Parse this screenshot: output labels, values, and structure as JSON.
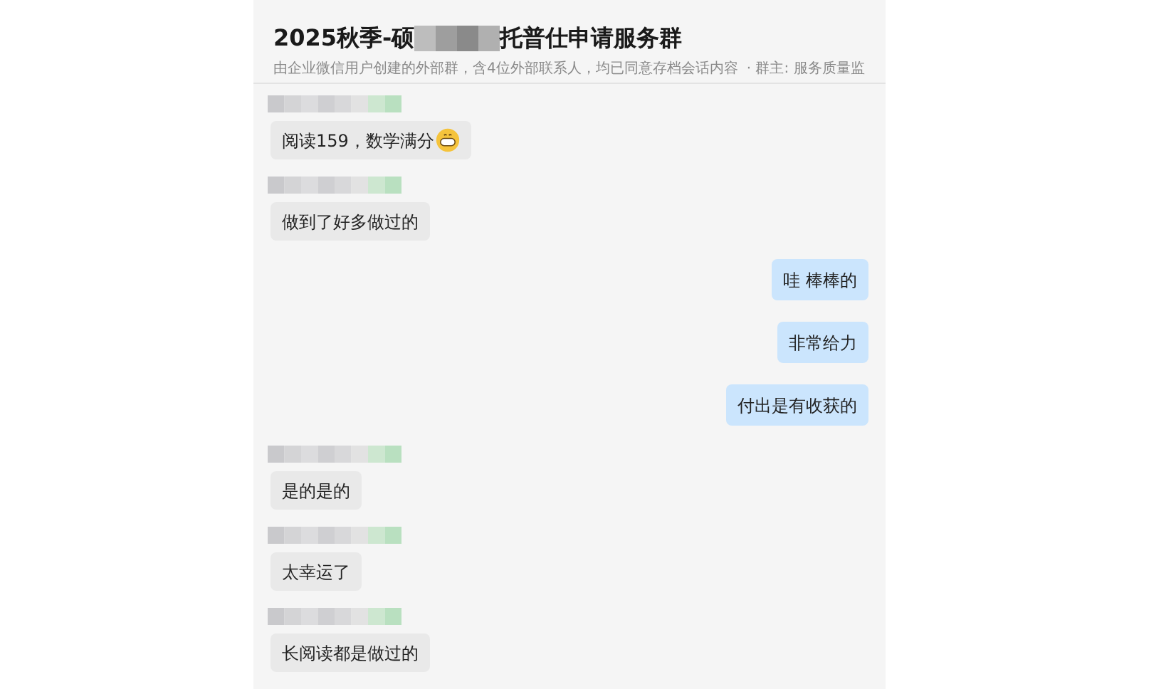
{
  "header": {
    "title_start": "2025秋季-硕",
    "title_end": "托普仕申请服务群",
    "subtitle": "由企业微信用户创建的外部群，含4位外部联系人，均已同意存档会话内容",
    "owner": "· 群主: 服务质量监"
  },
  "messages": [
    {
      "kind": "incoming",
      "text": "阅读159，数学满分",
      "trailing_emoji": true
    },
    {
      "kind": "incoming",
      "text": "做到了好多做过的",
      "trailing_emoji": false
    },
    {
      "kind": "outgoing",
      "text": "哇 棒棒的",
      "trailing_emoji": false
    },
    {
      "kind": "outgoing",
      "text": "非常给力",
      "trailing_emoji": false
    },
    {
      "kind": "outgoing",
      "text": "付出是有收获的",
      "trailing_emoji": false
    },
    {
      "kind": "incoming",
      "text": "是的是的",
      "trailing_emoji": false
    },
    {
      "kind": "incoming",
      "text": "太幸运了",
      "trailing_emoji": false
    },
    {
      "kind": "incoming",
      "text": "长阅读都是做过的",
      "trailing_emoji": false
    }
  ]
}
